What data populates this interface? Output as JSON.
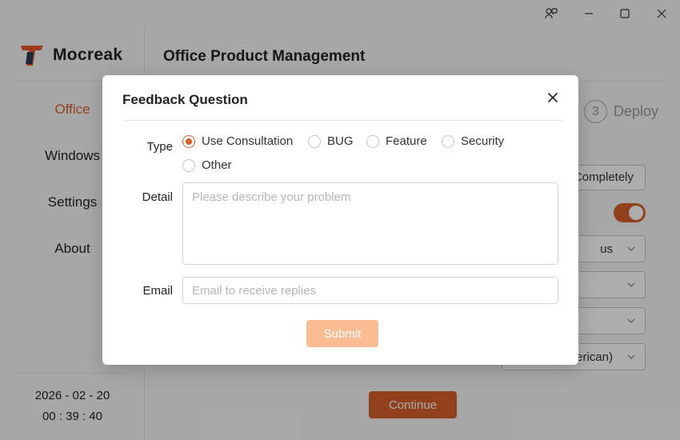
{
  "sidebar": {
    "brand": "Mocreak",
    "nav": [
      {
        "label": "Office",
        "active": true
      },
      {
        "label": "Windows",
        "active": false
      },
      {
        "label": "Settings",
        "active": false
      },
      {
        "label": "About",
        "active": false
      }
    ],
    "date": "2026 - 02 - 20",
    "time": "00 : 39 : 40"
  },
  "main": {
    "title": "Office Product Management",
    "step_number": "3",
    "step_label": "Deploy",
    "button_partial": "Completely",
    "select_values": [
      "us",
      "",
      "",
      "erican)"
    ],
    "continue_label": "Continue"
  },
  "modal": {
    "title": "Feedback Question",
    "type_label": "Type",
    "type_options": [
      "Use Consultation",
      "BUG",
      "Feature",
      "Security",
      "Other"
    ],
    "selected_type": "Use Consultation",
    "detail_label": "Detail",
    "detail_placeholder": "Please describe your problem",
    "email_label": "Email",
    "email_placeholder": "Email to receive replies",
    "submit_label": "Submit"
  },
  "colors": {
    "accent": "#d4602a",
    "submit_disabled": "#fbbc92"
  },
  "icons": {
    "titlebar": [
      "feedback-icon",
      "minimize-icon",
      "maximize-icon",
      "close-icon"
    ],
    "modal_close": "close-icon"
  }
}
